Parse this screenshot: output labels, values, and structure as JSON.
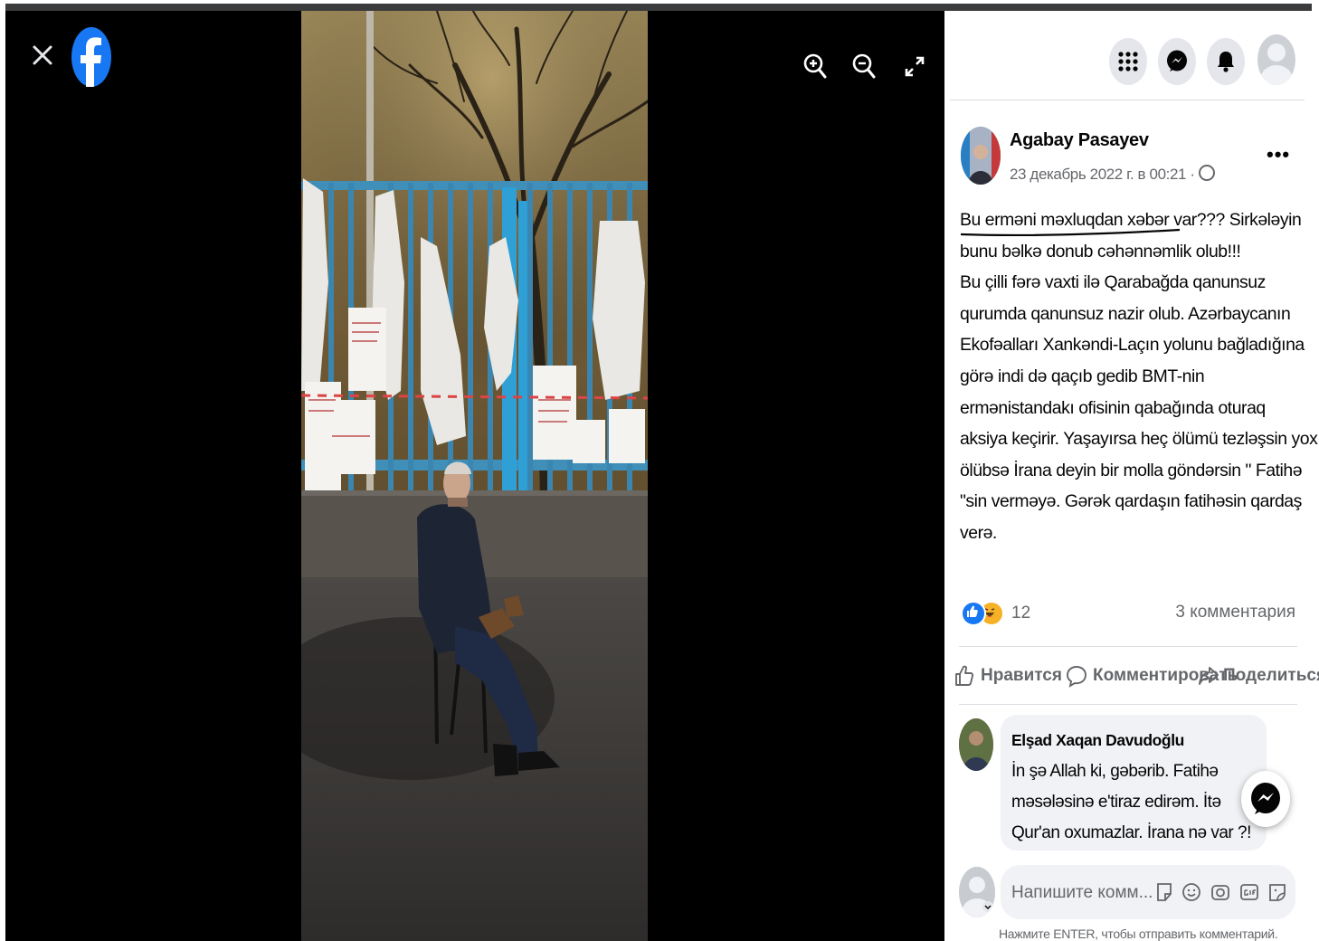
{
  "viewer": {
    "close_icon": "close-icon",
    "logo_icon": "facebook-logo-icon",
    "tools": [
      "zoom-in-icon",
      "zoom-out-icon",
      "fullscreen-icon"
    ]
  },
  "header": {
    "buttons": [
      "menu-grid-icon",
      "messenger-icon",
      "notifications-icon"
    ],
    "profile": "avatar"
  },
  "post": {
    "author": "Agabay Pasayev",
    "meta": "23 декабрь 2022 г. в 00:21 ·",
    "more": "•••",
    "text_lines": [
      "Bu erməni məxluqdan xəbər var??? Sirkələyin",
      "bunu bəlkə donub cəhənnəmlik olub!!!",
      "Bu çilli fərə vaxti ilə Qarabağda qanunsuz",
      "qurumda qanunsuz nazir olub. Azərbaycanın",
      "Ekofəalları Xankəndi-Laçın yolunu bağladığına",
      "görə indi də qaçıb gedib BMT-nin",
      "ermənistandakı ofisinin qabağında oturaq",
      "aksiya keçirir. Yaşayırsa heç ölümü tezləşsin yox",
      "ölübsə İrana deyin bir molla göndərsin \" Fatihə",
      "\"sin verməyə. Gərək qardaşın fatihəsin qardaş",
      "verə."
    ],
    "reactions_count": "12",
    "comments_count": "3 комментария"
  },
  "actions": {
    "like": "Нравится",
    "comment": "Комментировать",
    "share": "Поделиться"
  },
  "comment": {
    "author": "Elşad Xaqan Davudoğlu",
    "text_lines": [
      "İn şə Allah ki, gəbərib. Fatihə",
      "məsələsinə e'tiraz edirəm. İtə",
      "Qur'an oxumazlar. İrana nə var ?!"
    ]
  },
  "composer": {
    "placeholder": "Напишите комм...",
    "icons": [
      "sticker-icon",
      "emoji-icon",
      "camera-icon",
      "gif-icon",
      "avatar-sticker-icon"
    ],
    "hint": "Нажмите ENTER, чтобы отправить комментарий."
  },
  "colors": {
    "brand": "#1877f2",
    "viewer_bg": "#000000",
    "text_secondary": "#65676b"
  }
}
